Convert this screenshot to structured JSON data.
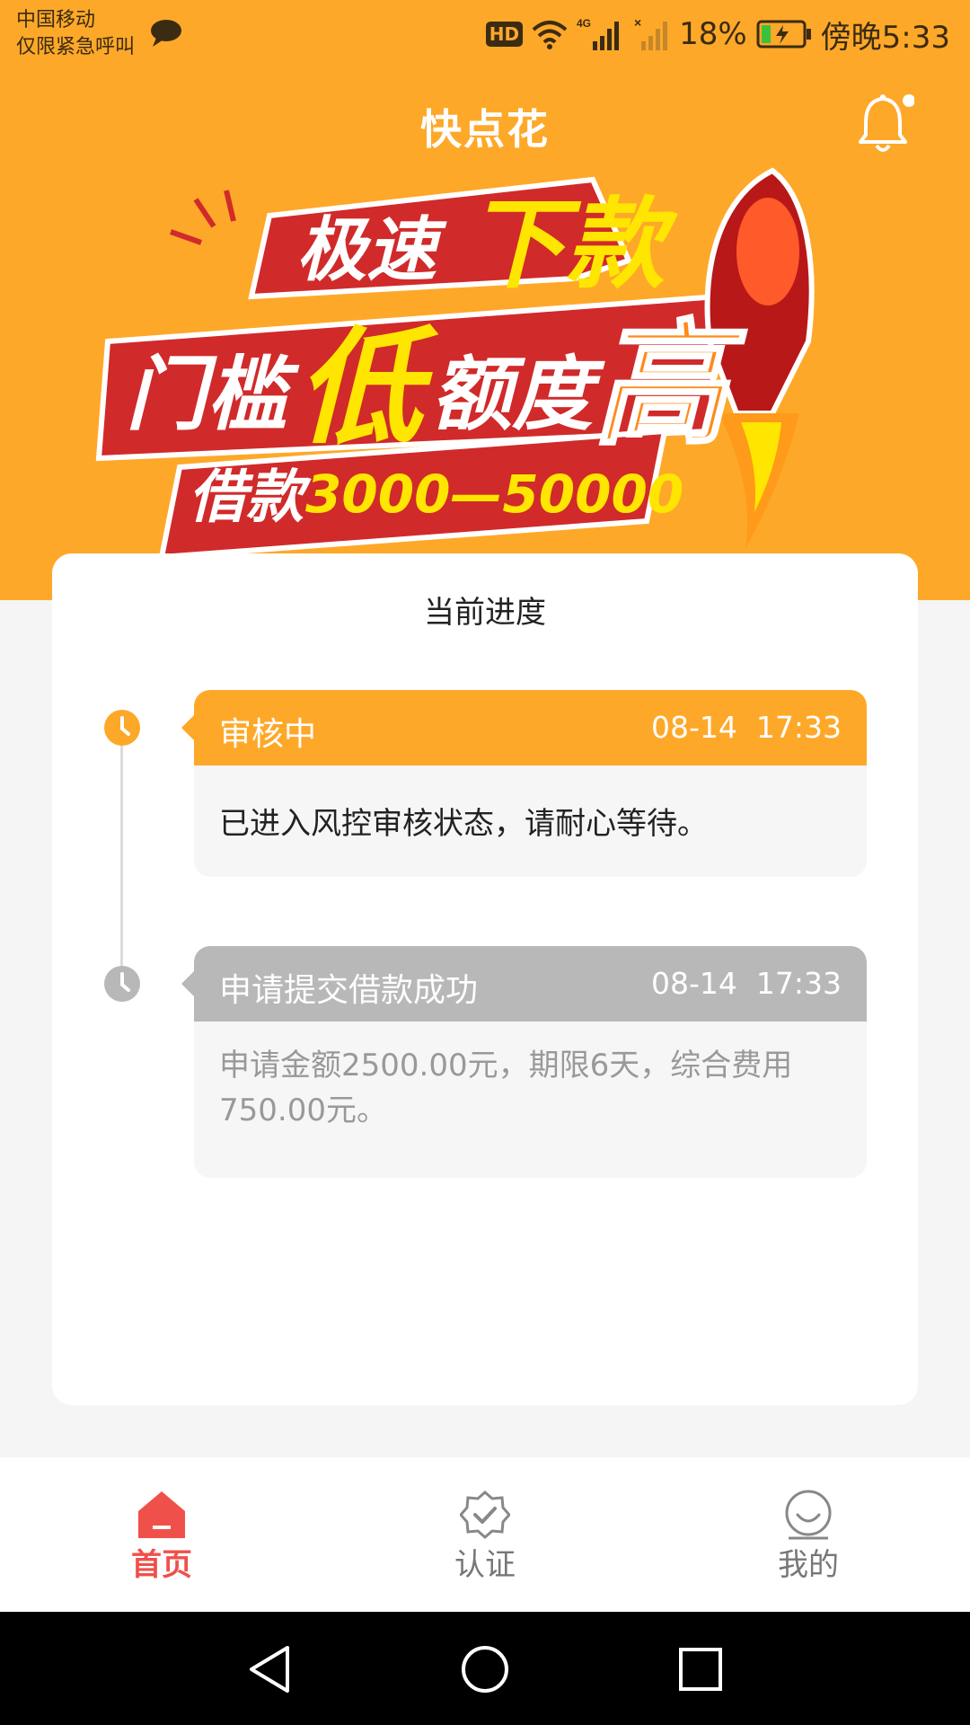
{
  "status_bar": {
    "carrier_line1": "中国移动",
    "carrier_line2": "仅限紧急呼叫",
    "hd": "HD",
    "network": "4G",
    "battery": "18%",
    "time": "傍晚5:33"
  },
  "header": {
    "title": "快点花"
  },
  "banner": {
    "line1_a": "极速",
    "line1_b": "下款",
    "line2_a": "门槛",
    "line2_b": "低",
    "line2_c": "额度",
    "line2_d": "高",
    "line3_a": "借款",
    "line3_b": "3000—50000"
  },
  "progress": {
    "title": "当前进度",
    "entries": [
      {
        "status": "审核中",
        "time": "08-14  17:33",
        "message": "已进入风控审核状态，请耐心等待。"
      },
      {
        "status": "申请提交借款成功",
        "time": "08-14  17:33",
        "message": "申请金额2500.00元，期限6天，综合费用750.00元。"
      }
    ]
  },
  "bottom_nav": {
    "items": [
      {
        "label": "首页",
        "icon": "home-icon",
        "active": true
      },
      {
        "label": "认证",
        "icon": "verify-icon",
        "active": false
      },
      {
        "label": "我的",
        "icon": "profile-icon",
        "active": false
      }
    ]
  },
  "colors": {
    "brand_orange": "#fea829",
    "active_red": "#f0504a",
    "inactive_gray": "#777777",
    "done_gray": "#b8b8b8"
  }
}
